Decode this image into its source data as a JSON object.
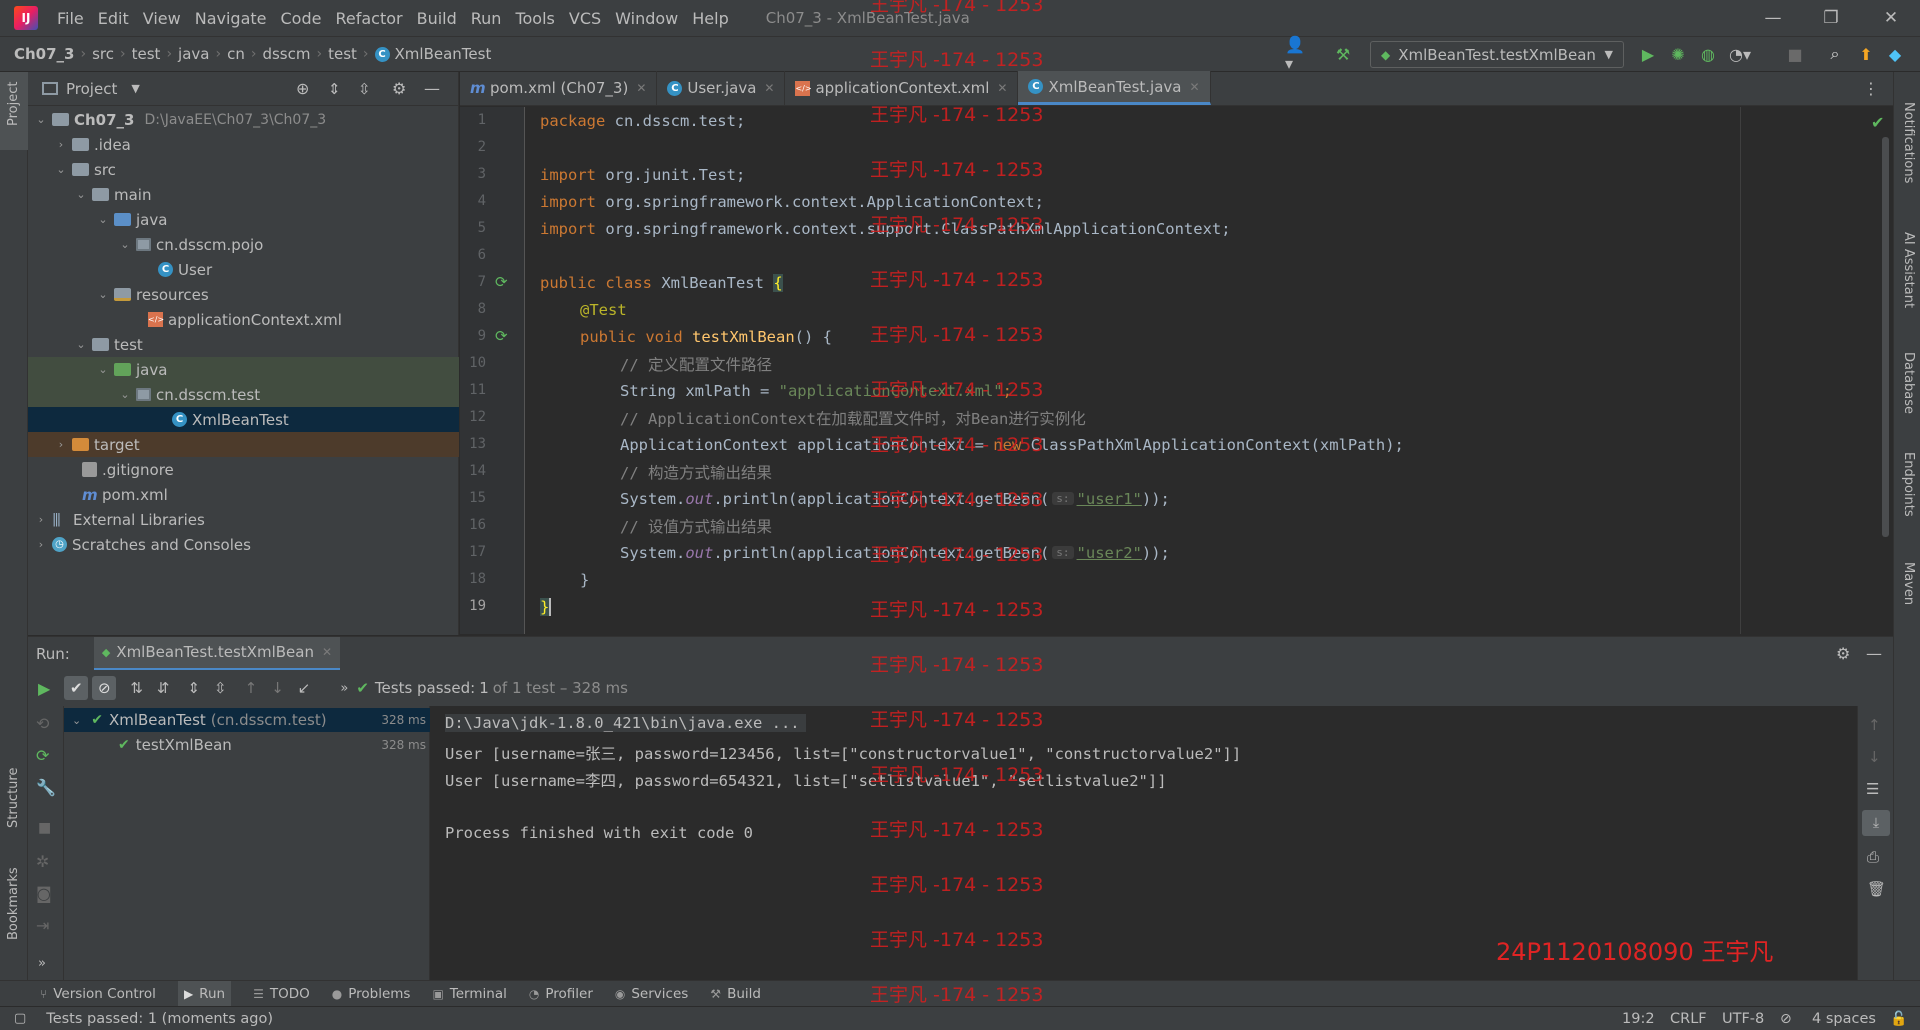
{
  "menubar": {
    "items": [
      "File",
      "Edit",
      "View",
      "Navigate",
      "Code",
      "Refactor",
      "Build",
      "Run",
      "Tools",
      "VCS",
      "Window",
      "Help"
    ],
    "window_title": "Ch07_3 - XmlBeanTest.java"
  },
  "navbar": {
    "breadcrumbs": [
      "Ch07_3",
      "src",
      "test",
      "java",
      "cn",
      "dsscm",
      "test",
      "XmlBeanTest"
    ],
    "run_config": "XmlBeanTest.testXmlBean"
  },
  "project": {
    "title": "Project",
    "tree": [
      {
        "label": "Ch07_3",
        "path": "D:\\JavaEE\\Ch07_3\\Ch07_3"
      },
      {
        "label": ".idea"
      },
      {
        "label": "src"
      },
      {
        "label": "main"
      },
      {
        "label": "java"
      },
      {
        "label": "cn.dsscm.pojo"
      },
      {
        "label": "User"
      },
      {
        "label": "resources"
      },
      {
        "label": "applicationContext.xml"
      },
      {
        "label": "test"
      },
      {
        "label": "java"
      },
      {
        "label": "cn.dsscm.test"
      },
      {
        "label": "XmlBeanTest"
      },
      {
        "label": "target"
      },
      {
        "label": ".gitignore"
      },
      {
        "label": "pom.xml"
      },
      {
        "label": "External Libraries"
      },
      {
        "label": "Scratches and Consoles"
      }
    ]
  },
  "editor": {
    "tabs": [
      {
        "label": "pom.xml (Ch07_3)"
      },
      {
        "label": "User.java"
      },
      {
        "label": "applicationContext.xml"
      },
      {
        "label": "XmlBeanTest.java"
      }
    ],
    "line_numbers": [
      "1",
      "2",
      "3",
      "4",
      "5",
      "6",
      "7",
      "8",
      "9",
      "10",
      "11",
      "12",
      "13",
      "14",
      "15",
      "16",
      "17",
      "18",
      "19"
    ],
    "code": {
      "l1_kw": "package",
      "l1_rest": " cn.dsscm.test;",
      "l3_kw": "import",
      "l3_rest": " org.junit.Test;",
      "l4_kw": "import",
      "l4_rest": " org.springframework.context.ApplicationContext;",
      "l5_kw": "import",
      "l5_rest": " org.springframework.context.support.ClassPathXmlApplicationContext;",
      "l7_kw": "public class",
      "l7_name": " XmlBeanTest ",
      "l7_brace": "{",
      "l8_ann": "@Test",
      "l9_kw": "public void",
      "l9_fn": "testXmlBean",
      "l9_rest": "() {",
      "l10_cm": "// 定义配置文件路径",
      "l11_a": "String xmlPath = ",
      "l11_str": "\"applicationContext.xml\"",
      "l11_b": ";",
      "l12_cm": "// ApplicationContext在加载配置文件时，对Bean进行实例化",
      "l13_a": "ApplicationContext applicationContext = ",
      "l13_kw": "new",
      "l13_b": " ClassPathXmlApplicationContext(xmlPath);",
      "l14_cm": "// 构造方式输出结果",
      "l15_a": "System.",
      "l15_it": "out",
      "l15_b": ".println(applicationContext.getBean(",
      "l15_hint": "s:",
      "l15_str": "\"user1\"",
      "l15_c": "));",
      "l16_cm": "// 设值方式输出结果",
      "l17_a": "System.",
      "l17_it": "out",
      "l17_b": ".println(applicationContext.getBean(",
      "l17_hint": "s:",
      "l17_str": "\"user2\"",
      "l17_c": "));",
      "l18": "}",
      "l19": "}"
    }
  },
  "run": {
    "label": "Run:",
    "tab": "XmlBeanTest.testXmlBean",
    "status_prefix": "Tests passed:",
    "status_count": "1",
    "status_suffix": "of 1 test – 328 ms",
    "tree": [
      {
        "name": "XmlBeanTest",
        "pkg": "(cn.dsscm.test)",
        "time": "328 ms"
      },
      {
        "name": "testXmlBean",
        "time": "328 ms"
      }
    ],
    "console": [
      "D:\\Java\\jdk-1.8.0_421\\bin\\java.exe ...",
      "User [username=张三, password=123456, list=[\"constructorvalue1\", \"constructorvalue2\"]]",
      "User [username=李四, password=654321, list=[\"setlistvalue1\", \"setlistvalue2\"]]",
      "",
      "Process finished with exit code 0"
    ]
  },
  "bottom_tools": [
    "Version Control",
    "Run",
    "TODO",
    "Problems",
    "Terminal",
    "Profiler",
    "Services",
    "Build"
  ],
  "left_stripe": [
    "Project",
    "Structure",
    "Bookmarks"
  ],
  "right_stripe": [
    "Notifications",
    "AI Assistant",
    "Database",
    "Endpoints",
    "Maven"
  ],
  "statusbar": {
    "message": "Tests passed: 1 (moments ago)",
    "position": "19:2",
    "line_sep": "CRLF",
    "encoding": "UTF-8",
    "indent": "4 spaces"
  },
  "watermark": {
    "repeated": "王宇凡 -174 - 1253",
    "signature": "24P1120108090 王宇凡"
  },
  "colors": {
    "accent": "#4a88c7",
    "pass_green": "#5fb85f",
    "watermark_red": "#d11f1f"
  }
}
